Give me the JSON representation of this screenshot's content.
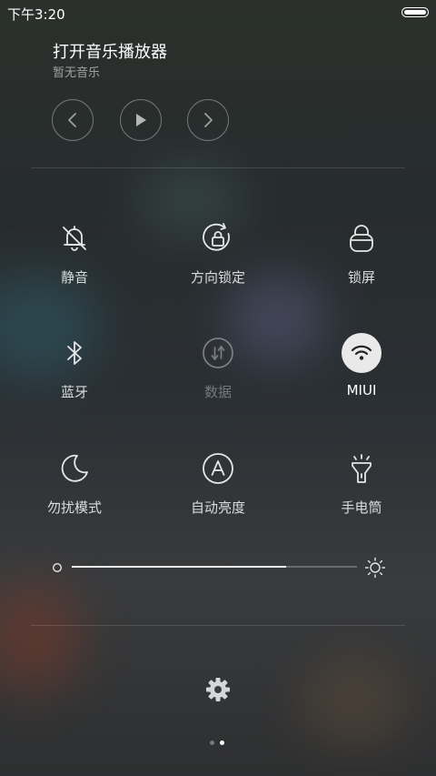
{
  "status_bar": {
    "time": "下午3:20"
  },
  "music": {
    "title": "打开音乐播放器",
    "subtitle": "暂无音乐",
    "controls": [
      "previous-icon",
      "play-icon",
      "next-icon"
    ]
  },
  "toggles": [
    {
      "label": "静音",
      "icon": "bell-off-icon",
      "state": "off"
    },
    {
      "label": "方向锁定",
      "icon": "rotation-lock-icon",
      "state": "off"
    },
    {
      "label": "锁屏",
      "icon": "lock-icon",
      "state": "off"
    },
    {
      "label": "蓝牙",
      "icon": "bluetooth-icon",
      "state": "off"
    },
    {
      "label": "数据",
      "icon": "mobile-data-icon",
      "state": "disabled"
    },
    {
      "label": "MIUI",
      "icon": "wifi-icon",
      "state": "on"
    },
    {
      "label": "勿扰模式",
      "icon": "moon-icon",
      "state": "off"
    },
    {
      "label": "自动亮度",
      "icon": "auto-brightness-icon",
      "state": "off"
    },
    {
      "label": "手电筒",
      "icon": "flashlight-icon",
      "state": "off"
    }
  ],
  "brightness": {
    "level": 0.75
  },
  "footer": {
    "page_count": 2,
    "active_page": 2
  },
  "colors": {
    "active_toggle_bg": "#e9e9e9",
    "icon": "#e6e6e6",
    "disabled": "#7a7d80"
  }
}
